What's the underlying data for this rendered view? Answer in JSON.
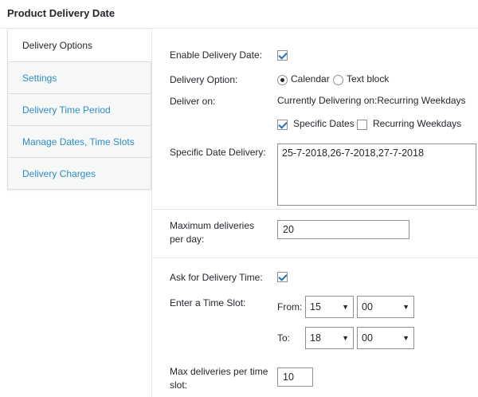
{
  "header": {
    "title": "Product Delivery Date"
  },
  "tabs": [
    {
      "label": "Delivery Options",
      "active": true
    },
    {
      "label": "Settings"
    },
    {
      "label": "Delivery Time Period"
    },
    {
      "label": "Manage Dates, Time Slots"
    },
    {
      "label": "Delivery Charges"
    }
  ],
  "form": {
    "enable_delivery_date": {
      "label": "Enable Delivery Date:",
      "checked": true
    },
    "delivery_option": {
      "label": "Delivery Option:",
      "calendar_label": "Calendar",
      "text_block_label": "Text block",
      "selected": "Calendar"
    },
    "deliver_on": {
      "label": "Deliver on:",
      "status": "Currently Delivering on:Recurring Weekdays",
      "specific_dates_label": "Specific Dates",
      "specific_dates_checked": true,
      "recurring_weekdays_label": "Recurring Weekdays",
      "recurring_weekdays_checked": false
    },
    "specific_date_delivery": {
      "label": "Specific Date Delivery:",
      "value": "25-7-2018,26-7-2018,27-7-2018"
    },
    "max_deliveries_per_day": {
      "label": "Maximum deliveries per day:",
      "value": "20"
    },
    "ask_delivery_time": {
      "label": "Ask for Delivery Time:",
      "checked": true
    },
    "time_slot": {
      "label": "Enter a Time Slot:",
      "from_label": "From:",
      "from_hour": "15",
      "from_minute": "00",
      "to_label": "To:",
      "to_hour": "18",
      "to_minute": "00"
    },
    "max_deliveries_per_slot": {
      "label": "Max deliveries per time slot:",
      "value": "10"
    }
  },
  "colors": {
    "link": "#2f8dc3",
    "checkmark": "#2271b1",
    "text": "#23282d"
  }
}
